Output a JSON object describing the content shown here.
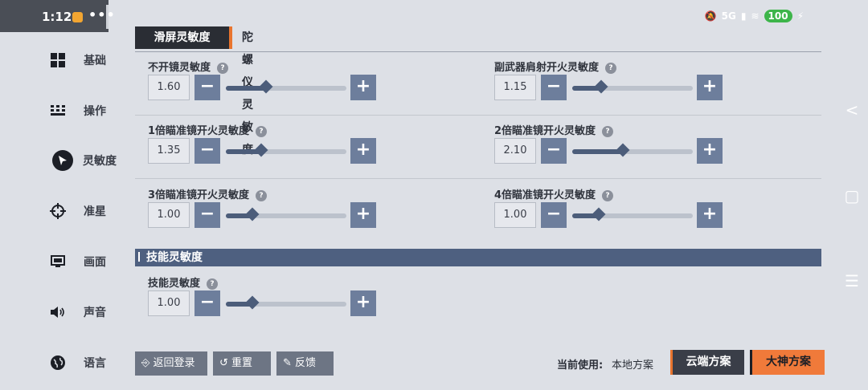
{
  "status_bar": {
    "time": "1:12",
    "network": "5G",
    "battery": "100"
  },
  "sidebar": {
    "items": [
      {
        "label": "基础",
        "icon": "grid-icon",
        "active": false
      },
      {
        "label": "操作",
        "icon": "keypad-icon",
        "active": false
      },
      {
        "label": "灵敏度",
        "icon": "cursor-icon",
        "active": true
      },
      {
        "label": "准星",
        "icon": "crosshair-icon",
        "active": false
      },
      {
        "label": "画面",
        "icon": "monitor-icon",
        "active": false
      },
      {
        "label": "声音",
        "icon": "speaker-icon",
        "active": false
      },
      {
        "label": "语言",
        "icon": "globe-icon",
        "active": false
      }
    ]
  },
  "tabs": [
    {
      "label": "滑屏灵敏度",
      "active": true
    },
    {
      "label": "陀螺仪灵敏度",
      "active": false
    }
  ],
  "settings": [
    {
      "label": "不开镜灵敏度",
      "value": "1.60",
      "fraction": 0.33
    },
    {
      "label": "副武器肩射开火灵敏度",
      "value": "1.15",
      "fraction": 0.24
    },
    {
      "label": "1倍瞄准镜开火灵敏度",
      "value": "1.35",
      "fraction": 0.29
    },
    {
      "label": "2倍瞄准镜开火灵敏度",
      "value": "2.10",
      "fraction": 0.42
    },
    {
      "label": "3倍瞄准镜开火灵敏度",
      "value": "1.00",
      "fraction": 0.22
    },
    {
      "label": "4倍瞄准镜开火灵敏度",
      "value": "1.00",
      "fraction": 0.22
    }
  ],
  "skill_section": {
    "title": "技能灵敏度",
    "settings": [
      {
        "label": "技能灵敏度",
        "value": "1.00",
        "fraction": 0.22
      }
    ]
  },
  "buttons": {
    "back_login": "返回登录",
    "reset": "重置",
    "feedback": "反馈",
    "minus": "−",
    "plus": "+",
    "help": "?"
  },
  "scheme": {
    "current_label": "当前使用:",
    "current_value": "本地方案",
    "cloud": "云端方案",
    "pro": "大神方案"
  },
  "colors": {
    "accent": "#e8742e",
    "slider": "#4c5d7a",
    "button": "#6d7e9c",
    "section": "#4e6080"
  }
}
